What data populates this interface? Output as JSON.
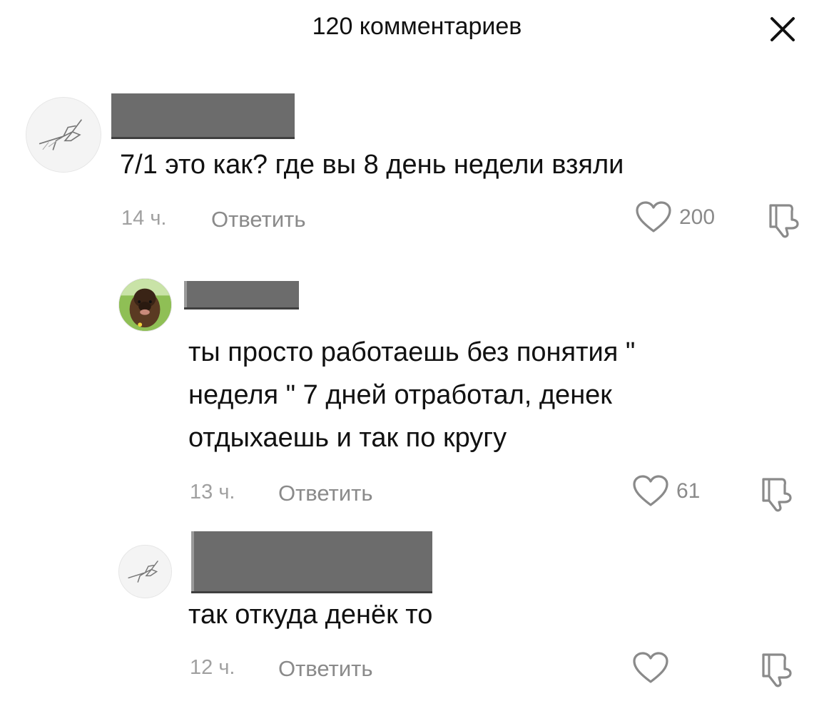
{
  "header": {
    "title": "120 комментариев"
  },
  "comments": [
    {
      "text": [
        "7/1 это как? где вы 8 день недели взяли"
      ],
      "time": "14 ч.",
      "reply_label": "Ответить",
      "likes": "200"
    },
    {
      "text": [
        "ты просто работаешь без понятия \"",
        "неделя \" 7 дней отработал, денек",
        "отдыхаешь и так по кругу"
      ],
      "time": "13 ч.",
      "reply_label": "Ответить",
      "likes": "61"
    },
    {
      "text": [
        "так откуда денёк то"
      ],
      "time": "12 ч.",
      "reply_label": "Ответить",
      "likes": ""
    }
  ],
  "icons": {
    "close": "close-icon",
    "like": "heart-icon",
    "dislike": "thumbs-down-icon",
    "avatar_bird": "bird-sketch-avatar",
    "avatar_dog": "dog-photo-avatar"
  },
  "colors": {
    "text": "#111111",
    "meta": "#8a8a8a",
    "redaction": "#6c6c6c"
  }
}
